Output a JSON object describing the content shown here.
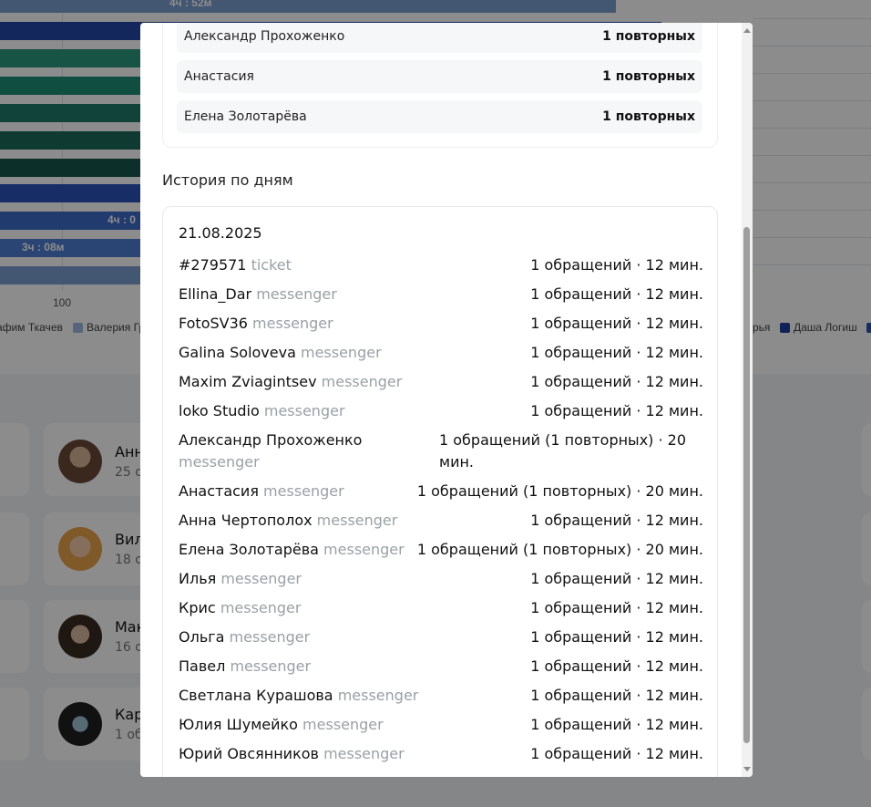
{
  "background": {
    "bar_labels": [
      "4ч : 52м",
      "4ч : 0",
      "3ч : 08м"
    ],
    "axis_tick": "100",
    "legend": [
      {
        "label": "афим Ткачев",
        "color": "#4a7bd4"
      },
      {
        "label": "Валерия Гр",
        "color": "#9bb8e0"
      },
      {
        "label": "рья",
        "color": "#9bb8e0"
      },
      {
        "label": "Даша Логиш",
        "color": "#1f3f9e"
      }
    ],
    "cards": [
      {
        "name": "Анн",
        "sub": "25 о"
      },
      {
        "name": "Вил",
        "sub": "18 о"
      },
      {
        "name": "Мак",
        "sub": "16 о"
      },
      {
        "name": "Кар",
        "sub": "1 обр"
      }
    ]
  },
  "modal": {
    "repeat_list": [
      {
        "name": "Александр Прохоженко",
        "value": "1 повторных"
      },
      {
        "name": "Анастасия",
        "value": "1 повторных"
      },
      {
        "name": "Елена Золотарёва",
        "value": "1 повторных"
      }
    ],
    "history_title": "История по дням",
    "history": {
      "date": "21.08.2025",
      "rows": [
        {
          "name": "#279571",
          "source": "ticket",
          "stats": "1 обращений · 12 мин."
        },
        {
          "name": "Ellina_Dar",
          "source": "messenger",
          "stats": "1 обращений · 12 мин."
        },
        {
          "name": "FotoSV36",
          "source": "messenger",
          "stats": "1 обращений · 12 мин."
        },
        {
          "name": "Galina Soloveva",
          "source": "messenger",
          "stats": "1 обращений · 12 мин."
        },
        {
          "name": "Maxim Zviagintsev",
          "source": "messenger",
          "stats": "1 обращений · 12 мин."
        },
        {
          "name": "loko Studio",
          "source": "messenger",
          "stats": "1 обращений · 12 мин."
        },
        {
          "name": "Александр Прохоженко",
          "source": "messenger",
          "stats": "1 обращений (1 повторных) · 20 мин."
        },
        {
          "name": "Анастасия",
          "source": "messenger",
          "stats": "1 обращений (1 повторных) · 20 мин."
        },
        {
          "name": "Анна Чертополох",
          "source": "messenger",
          "stats": "1 обращений · 12 мин."
        },
        {
          "name": "Елена Золотарёва",
          "source": "messenger",
          "stats": "1 обращений (1 повторных) · 20 мин."
        },
        {
          "name": "Илья",
          "source": "messenger",
          "stats": "1 обращений · 12 мин."
        },
        {
          "name": "Крис",
          "source": "messenger",
          "stats": "1 обращений · 12 мин."
        },
        {
          "name": "Ольга",
          "source": "messenger",
          "stats": "1 обращений · 12 мин."
        },
        {
          "name": "Павел",
          "source": "messenger",
          "stats": "1 обращений · 12 мин."
        },
        {
          "name": "Светлана Курашова",
          "source": "messenger",
          "stats": "1 обращений · 12 мин."
        },
        {
          "name": "Юлия Шумейко",
          "source": "messenger",
          "stats": "1 обращений · 12 мин."
        },
        {
          "name": "Юрий Овсянников",
          "source": "messenger",
          "stats": "1 обращений · 12 мин."
        }
      ]
    }
  }
}
